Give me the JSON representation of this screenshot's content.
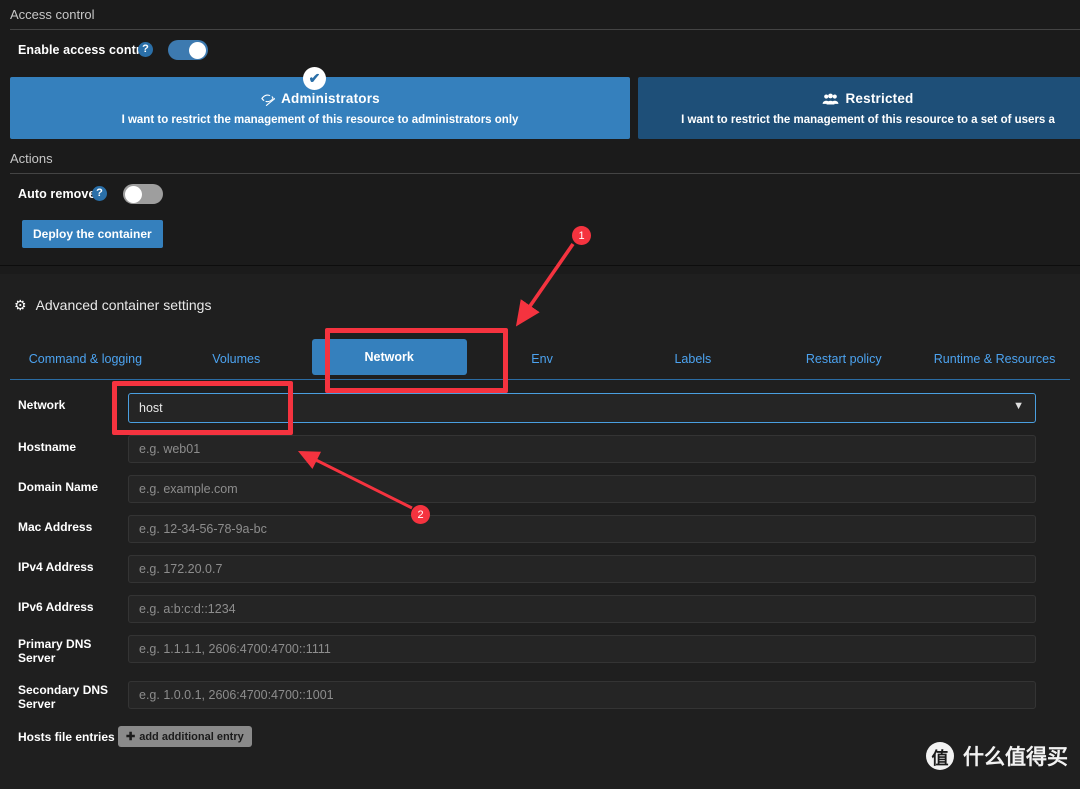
{
  "access_control": {
    "section_title": "Access control",
    "enable_label": "Enable access control",
    "enable_state": "on",
    "help_glyph": "?",
    "cards": [
      {
        "title": "Administrators",
        "icon": "eye-slash-icon",
        "description": "I want to restrict the management of this resource to administrators only",
        "selected": true,
        "check_glyph": "✔",
        "color": "#3580bd"
      },
      {
        "title": "Restricted",
        "icon": "users-icon",
        "description": "I want to restrict the management of this resource to a set of users a",
        "selected": false,
        "color": "#1e4f78"
      }
    ]
  },
  "actions": {
    "section_title": "Actions",
    "auto_remove_label": "Auto remove",
    "auto_remove_state": "off",
    "deploy_label": "Deploy the container"
  },
  "advanced": {
    "title": "Advanced container settings",
    "icon": "gear-icon",
    "tabs": [
      {
        "label": "Command & logging",
        "active": false
      },
      {
        "label": "Volumes",
        "active": false
      },
      {
        "label": "Network",
        "active": true
      },
      {
        "label": "Env",
        "active": false
      },
      {
        "label": "Labels",
        "active": false
      },
      {
        "label": "Restart policy",
        "active": false
      },
      {
        "label": "Runtime & Resources",
        "active": false
      }
    ],
    "fields": [
      {
        "label": "Network",
        "type": "select",
        "value": "host"
      },
      {
        "label": "Hostname",
        "type": "text",
        "value": "",
        "placeholder": "e.g. web01"
      },
      {
        "label": "Domain Name",
        "type": "text",
        "value": "",
        "placeholder": "e.g. example.com"
      },
      {
        "label": "Mac Address",
        "type": "text",
        "value": "",
        "placeholder": "e.g. 12-34-56-78-9a-bc"
      },
      {
        "label": "IPv4 Address",
        "type": "text",
        "value": "",
        "placeholder": "e.g. 172.20.0.7"
      },
      {
        "label": "IPv6 Address",
        "type": "text",
        "value": "",
        "placeholder": "e.g. a:b:c:d::1234"
      },
      {
        "label": "Primary DNS Server",
        "type": "text",
        "value": "",
        "placeholder": "e.g. 1.1.1.1, 2606:4700:4700::1111"
      },
      {
        "label": "Secondary DNS Server",
        "type": "text",
        "value": "",
        "placeholder": "e.g. 1.0.0.1, 2606:4700:4700::1001"
      }
    ],
    "hosts_file": {
      "label": "Hosts file entries",
      "add_label": "add additional entry",
      "add_icon": "plus-circle-icon"
    }
  },
  "annotations": {
    "color": "#f5333f",
    "badges": [
      {
        "number": "1",
        "target": "network-tab"
      },
      {
        "number": "2",
        "target": "network-select"
      }
    ]
  },
  "watermark": {
    "logo_text": "值",
    "text": "什么值得买"
  }
}
